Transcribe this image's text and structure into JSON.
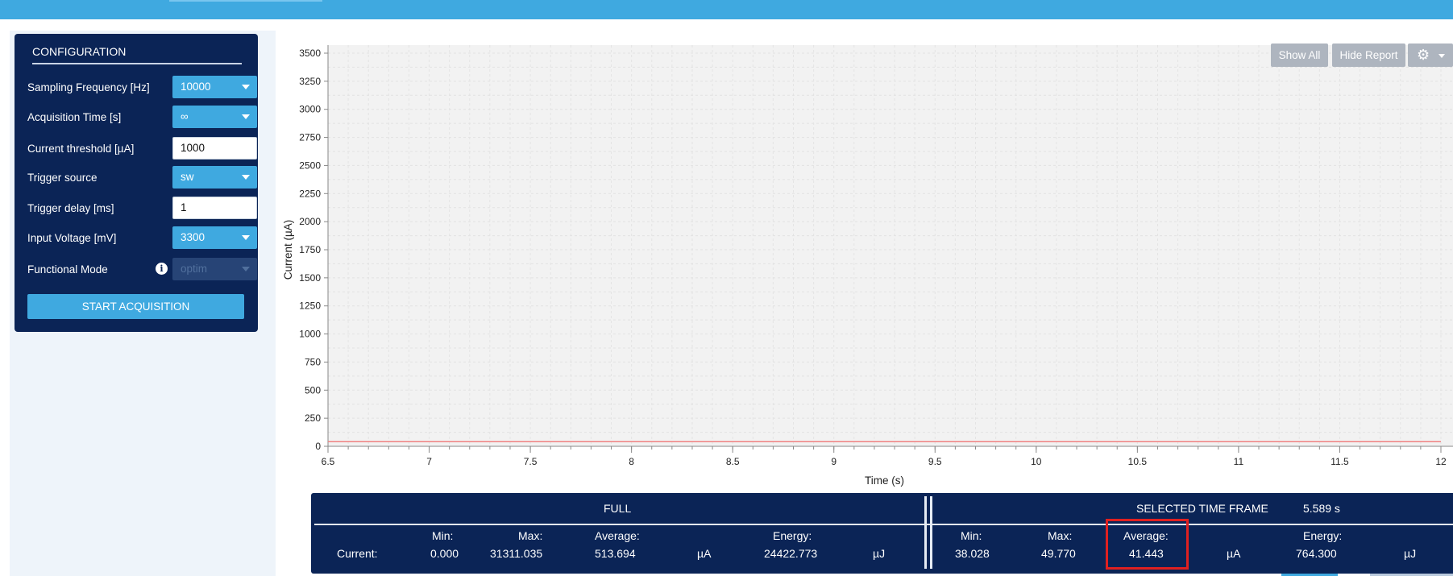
{
  "config": {
    "title": "CONFIGURATION",
    "sampling_frequency": {
      "label": "Sampling Frequency [Hz]",
      "value": "10000"
    },
    "acquisition_time": {
      "label": "Acquisition Time [s]",
      "value": "∞"
    },
    "current_threshold": {
      "label": "Current threshold [µA]",
      "value": "1000"
    },
    "trigger_source": {
      "label": "Trigger source",
      "value": "sw"
    },
    "trigger_delay": {
      "label": "Trigger delay [ms]",
      "value": "1"
    },
    "input_voltage": {
      "label": "Input Voltage [mV]",
      "value": "3300"
    },
    "functional_mode": {
      "label": "Functional Mode",
      "value": "optim"
    },
    "start_button": "START ACQUISITION"
  },
  "toolbar": {
    "show_all": "Show All",
    "hide_report": "Hide Report",
    "settings_icon": "gear-icon"
  },
  "chart_data": {
    "type": "line",
    "xlabel": "Time (s)",
    "ylabel": "Current (µA)",
    "xlim": [
      6.5,
      12
    ],
    "ylim": [
      0,
      3500
    ],
    "x_ticks": [
      "6.5",
      "7",
      "7.5",
      "8",
      "8.5",
      "9",
      "9.5",
      "10",
      "10.5",
      "11",
      "11.5",
      "12"
    ],
    "y_ticks": [
      "0",
      "250",
      "500",
      "750",
      "1000",
      "1250",
      "1500",
      "1750",
      "2000",
      "2250",
      "2500",
      "2750",
      "3000",
      "3250",
      "3500"
    ],
    "grid": true,
    "series": [
      {
        "x": [
          6.5,
          12
        ],
        "y": [
          41.443,
          41.443
        ],
        "color": "#f08080"
      }
    ]
  },
  "stats": {
    "full_label": "FULL",
    "selected_label": "SELECTED TIME FRAME",
    "selected_duration": "5.589 s",
    "row_label": "Current:",
    "headers": {
      "min": "Min:",
      "max": "Max:",
      "average": "Average:",
      "energy": "Energy:"
    },
    "full": {
      "min": "0.000",
      "max": "31311.035",
      "average": "513.694",
      "avg_unit": "µA",
      "energy": "24422.773",
      "energy_unit": "µJ"
    },
    "selected": {
      "min": "38.028",
      "max": "49.770",
      "average": "41.443",
      "avg_unit": "µA",
      "energy": "764.300",
      "energy_unit": "µJ"
    }
  }
}
